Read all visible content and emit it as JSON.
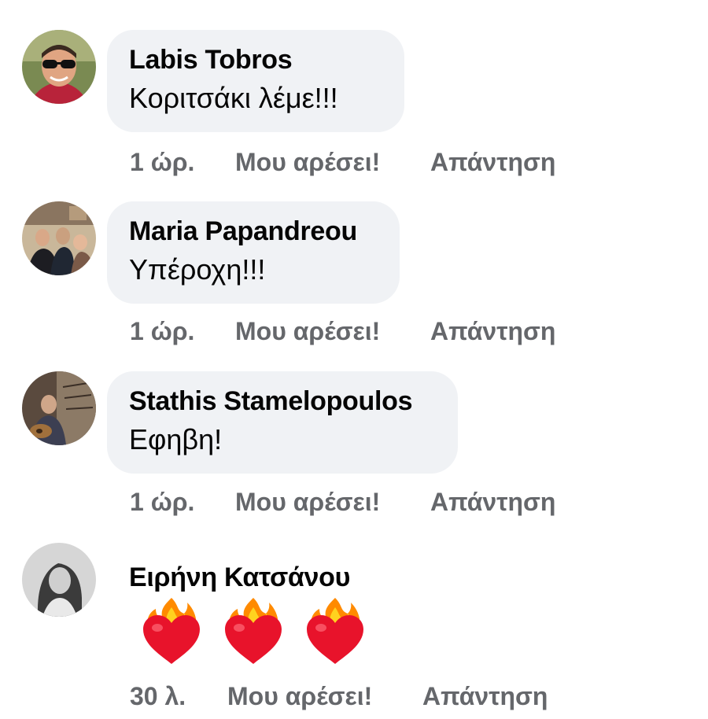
{
  "comments": [
    {
      "author": "Labis Tobros",
      "text": "Κοριτσάκι λέμε!!!",
      "time": "1 ώρ.",
      "like_label": "Μου αρέσει!",
      "reply_label": "Απάντηση"
    },
    {
      "author": "Maria Papandreou",
      "text": "Υπέροχη!!!",
      "time": "1 ώρ.",
      "like_label": "Μου αρέσει!",
      "reply_label": "Απάντηση"
    },
    {
      "author": "Stathis Stamelopoulos",
      "text": "Εφηβη!",
      "time": "1 ώρ.",
      "like_label": "Μου αρέσει!",
      "reply_label": "Απάντηση"
    },
    {
      "author": "Ειρήνη Κατσάνου",
      "emojis": [
        "heart-on-fire",
        "heart-on-fire",
        "heart-on-fire"
      ],
      "time": "30 λ.",
      "like_label": "Μου αρέσει!",
      "reply_label": "Απάντηση"
    }
  ],
  "colors": {
    "bubble": "#f0f2f5",
    "meta_text": "#65676b",
    "author_text": "#050505"
  }
}
